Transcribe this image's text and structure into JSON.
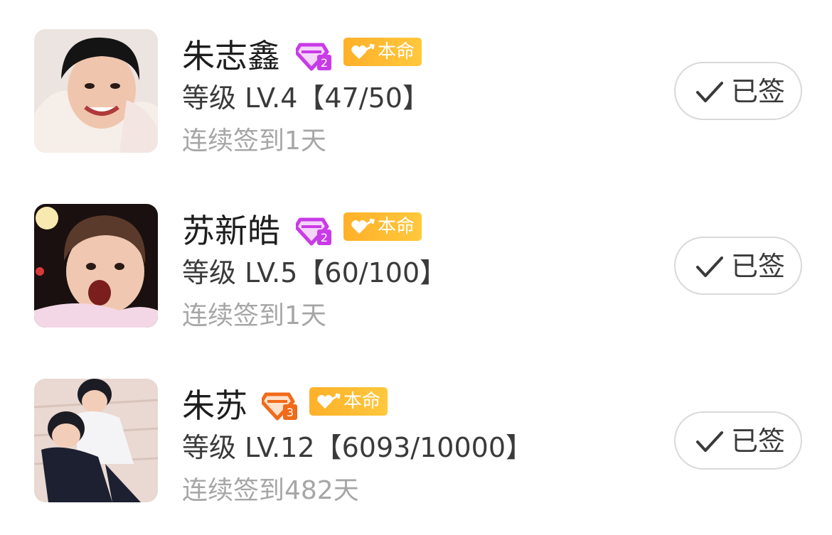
{
  "members": [
    {
      "name": "朱志鑫",
      "level_icon": "purple-diamond-level-2-icon",
      "badge": "本命",
      "level": "等级 LV.4【47/50】",
      "streak": "连续签到1天",
      "button": "已签"
    },
    {
      "name": "苏新皓",
      "level_icon": "purple-diamond-level-2-icon",
      "badge": "本命",
      "level": "等级 LV.5【60/100】",
      "streak": "连续签到1天",
      "button": "已签"
    },
    {
      "name": "朱苏",
      "level_icon": "orange-diamond-level-3-icon",
      "badge": "本命",
      "level": "等级 LV.12【6093/10000】",
      "streak": "连续签到482天",
      "button": "已签"
    }
  ],
  "colors": {
    "badge_start": "#ffb029",
    "badge_end": "#ffc83d",
    "diamond_purple": "#c93be6",
    "diamond_orange": "#f06a1a",
    "name_text": "#1d1d1d",
    "secondary_text": "#a6a6a6",
    "button_border": "#d9d9d9"
  }
}
